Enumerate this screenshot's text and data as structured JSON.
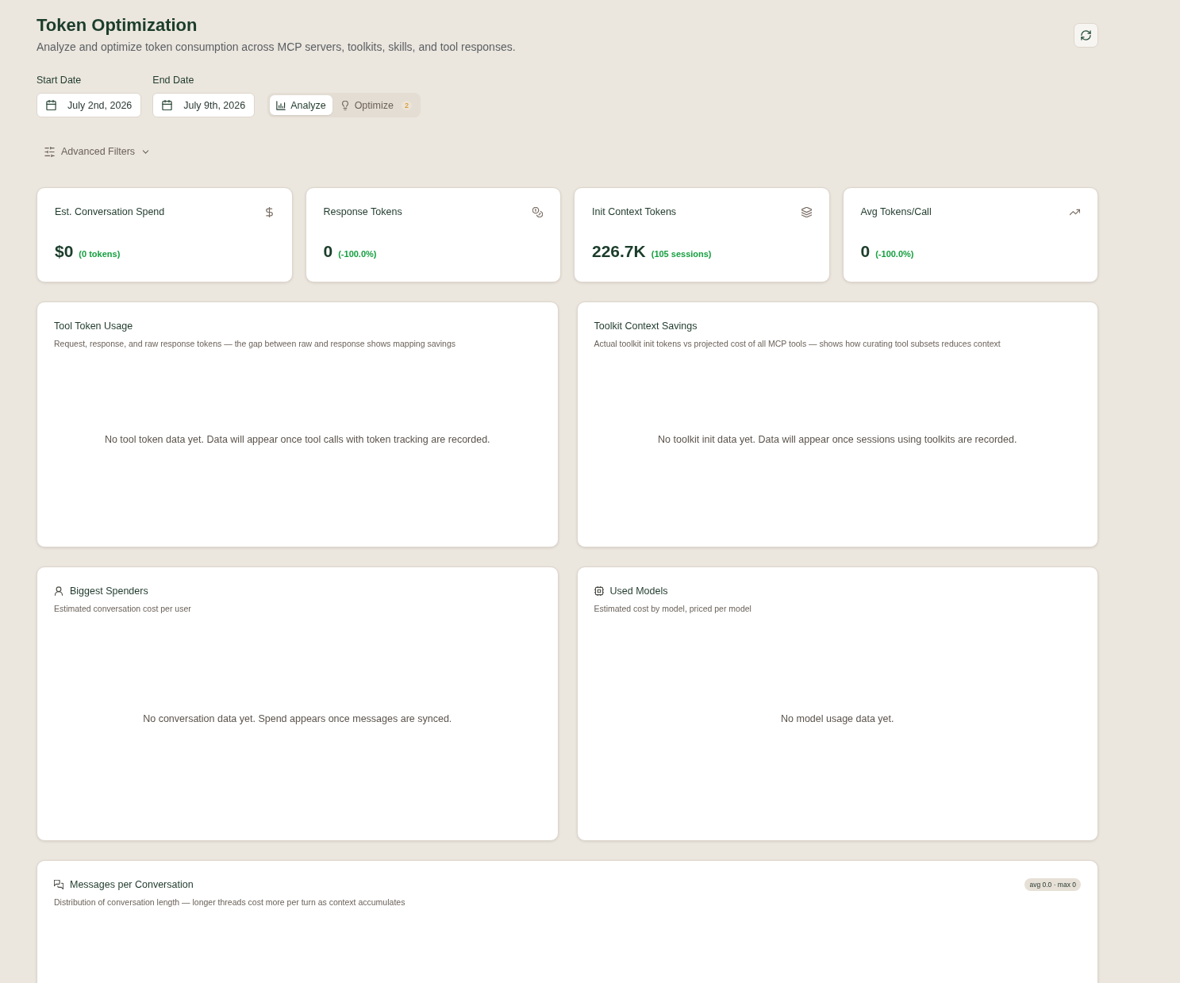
{
  "header": {
    "title": "Token Optimization",
    "subtitle": "Analyze and optimize token consumption across MCP servers, toolkits, skills, and tool responses."
  },
  "filters": {
    "start_date": {
      "label": "Start Date",
      "value": "July 2nd, 2026"
    },
    "end_date": {
      "label": "End Date",
      "value": "July 9th, 2026"
    },
    "modes": [
      {
        "label": "Analyze",
        "selected": true,
        "kind": "analyze"
      },
      {
        "label": "Optimize",
        "selected": false,
        "kind": "optimize",
        "badge": "2"
      }
    ],
    "advanced_filters": {
      "label": "Advanced Filters",
      "expanded": false
    }
  },
  "stats": [
    {
      "kind": "spend",
      "title": "Est. Conversation Spend",
      "value": "$0",
      "change": "(0 tokens)"
    },
    {
      "kind": "response",
      "title": "Response Tokens",
      "value": "0",
      "change": "(-100.0%)"
    },
    {
      "kind": "context",
      "title": "Init Context Tokens",
      "value": "226.7K",
      "change": "(105 sessions)"
    },
    {
      "kind": "average",
      "title": "Avg Tokens/Call",
      "value": "0",
      "change": "(-100.0%)"
    }
  ],
  "panel_rows": [
    [
      {
        "kind": "tools",
        "title": "Tool Token Usage",
        "subtitle": "Request, response, and raw response tokens — the gap between raw and response shows mapping savings",
        "empty_message": "No tool token data yet. Data will appear once tool calls with token tracking are recorded."
      },
      {
        "kind": "toolkits",
        "title": "Toolkit Context Savings",
        "subtitle": "Actual toolkit init tokens vs projected cost of all MCP tools — shows how curating tool subsets reduces context",
        "empty_message": "No toolkit init data yet. Data will appear once sessions using toolkits are recorded."
      }
    ],
    [
      {
        "kind": "spenders",
        "title": "Biggest Spenders",
        "subtitle": "Estimated conversation cost per user",
        "empty_message": "No conversation data yet. Spend appears once messages are synced."
      },
      {
        "kind": "models",
        "title": "Used Models",
        "subtitle": "Estimated cost by model, priced per model",
        "empty_message": "No model usage data yet."
      }
    ],
    [
      {
        "kind": "messages",
        "title": "Messages per Conversation",
        "subtitle": "Distribution of conversation length — longer threads cost more per turn as context accumulates",
        "badge": "avg 0.0 · max 0"
      }
    ]
  ]
}
